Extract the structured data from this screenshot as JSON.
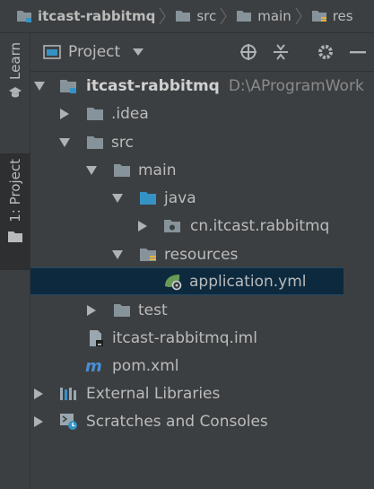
{
  "breadcrumbs": [
    {
      "label": "itcast-rabbitmq",
      "icon": "module-folder-icon",
      "bold": true
    },
    {
      "label": "src",
      "icon": "folder-icon",
      "bold": false
    },
    {
      "label": "main",
      "icon": "folder-icon",
      "bold": false
    },
    {
      "label": "res",
      "icon": "resources-folder-icon",
      "bold": false
    }
  ],
  "tool_strip": {
    "learn_label": "Learn",
    "project_label": "1: Project"
  },
  "panel": {
    "title": "Project"
  },
  "tree": {
    "root_label": "itcast-rabbitmq",
    "root_path": "D:\\AProgramWork",
    "idea_label": ".idea",
    "src_label": "src",
    "main_label": "main",
    "java_label": "java",
    "package_label": "cn.itcast.rabbitmq",
    "resources_label": "resources",
    "app_yml_label": "application.yml",
    "test_label": "test",
    "iml_label": "itcast-rabbitmq.iml",
    "pom_label": "pom.xml",
    "ext_libs_label": "External Libraries",
    "scratches_label": "Scratches and Consoles"
  },
  "colors": {
    "background": "#3c3f41",
    "selection": "#0d293e",
    "folder": "#87939a",
    "java_folder": "#3592c4",
    "resources_badge": "#e3b341",
    "spring_green": "#6a9b56",
    "maven_blue": "#4a8fd3"
  }
}
